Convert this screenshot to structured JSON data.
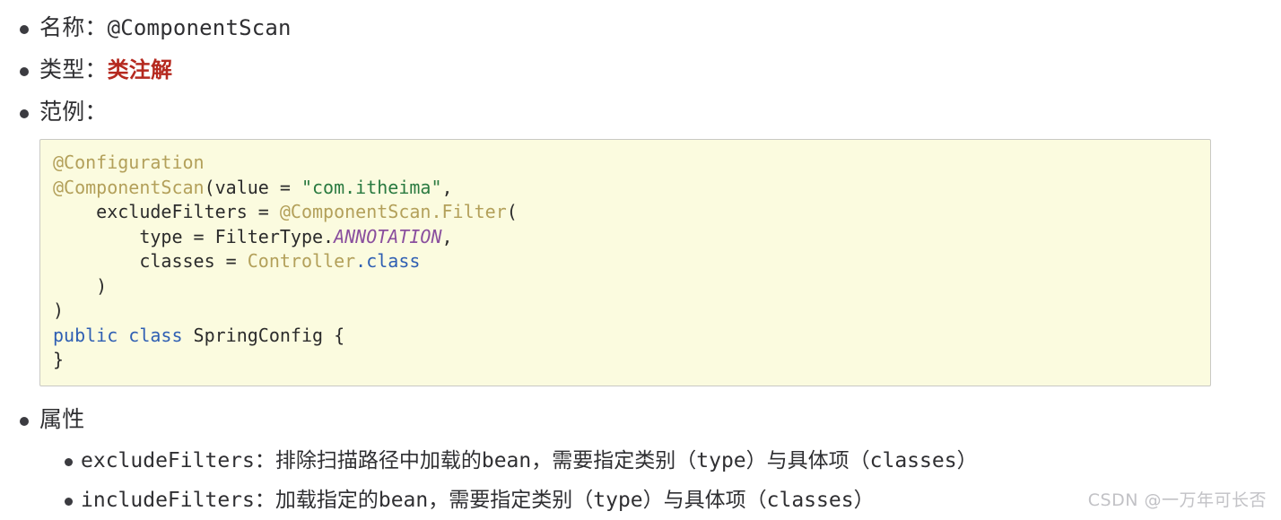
{
  "doc": {
    "bullet_glyph": "filled-circle",
    "accent_color": "#b5291f",
    "code_bg_color": "#fbfbdf",
    "code_border_color": "#c9c9c4"
  },
  "items": [
    {
      "label": "名称：",
      "value": "@ComponentScan"
    },
    {
      "label": "类型：",
      "value": "类注解"
    },
    {
      "label": "范例：",
      "value": ""
    },
    {
      "label": "属性",
      "value": ""
    }
  ],
  "code": {
    "language": "java",
    "lines": [
      [
        {
          "t": "@Configuration",
          "c": "annotation"
        }
      ],
      [
        {
          "t": "@ComponentScan",
          "c": "annotation"
        },
        {
          "t": "(value = ",
          "c": "plain"
        },
        {
          "t": "\"com.itheima\"",
          "c": "string"
        },
        {
          "t": ",",
          "c": "plain"
        }
      ],
      [
        {
          "t": "    excludeFilters = ",
          "c": "plain"
        },
        {
          "t": "@ComponentScan.Filter",
          "c": "annotation"
        },
        {
          "t": "(",
          "c": "plain"
        }
      ],
      [
        {
          "t": "        type = FilterType.",
          "c": "plain"
        },
        {
          "t": "ANNOTATION",
          "c": "enum"
        },
        {
          "t": ",",
          "c": "plain"
        }
      ],
      [
        {
          "t": "        classes = ",
          "c": "plain"
        },
        {
          "t": "Controller",
          "c": "type"
        },
        {
          "t": ".class",
          "c": "keyword"
        }
      ],
      [
        {
          "t": "    )",
          "c": "plain"
        }
      ],
      [
        {
          "t": ")",
          "c": "plain"
        }
      ],
      [
        {
          "t": "public class",
          "c": "keyword"
        },
        {
          "t": " SpringConfig {",
          "c": "plain"
        }
      ],
      [
        {
          "t": "}",
          "c": "plain"
        }
      ]
    ]
  },
  "attributes": [
    "excludeFilters：排除扫描路径中加载的bean，需要指定类别（type）与具体项（classes）",
    "includeFilters：加载指定的bean，需要指定类别（type）与具体项（classes）"
  ],
  "watermark": "CSDN @一万年可长否"
}
